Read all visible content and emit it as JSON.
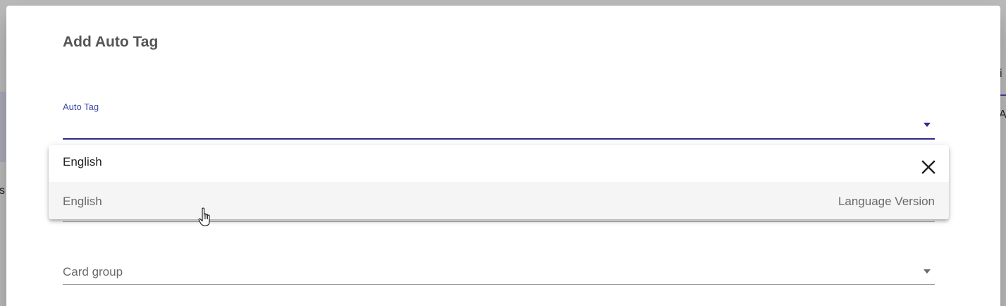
{
  "background": {
    "left_text": "s",
    "right_tab_text": "i",
    "right_text": "A"
  },
  "dialog": {
    "title": "Add Auto Tag",
    "auto_tag_field": {
      "label": "Auto Tag",
      "value": ""
    },
    "dropdown": {
      "search_value": "English",
      "options": [
        {
          "label": "English",
          "type": "Language Version"
        }
      ]
    },
    "card_group_field": {
      "placeholder": "Card group"
    }
  },
  "colors": {
    "accent": "#2c2c8a",
    "label_accent": "#3f4aa8",
    "title": "#555555",
    "muted": "#6a6a6a",
    "hover": "#f5f5f5"
  },
  "icons": {
    "close": "close-icon",
    "dropdown_arrow": "chevron-down-icon",
    "cursor": "hand-pointer-icon"
  }
}
